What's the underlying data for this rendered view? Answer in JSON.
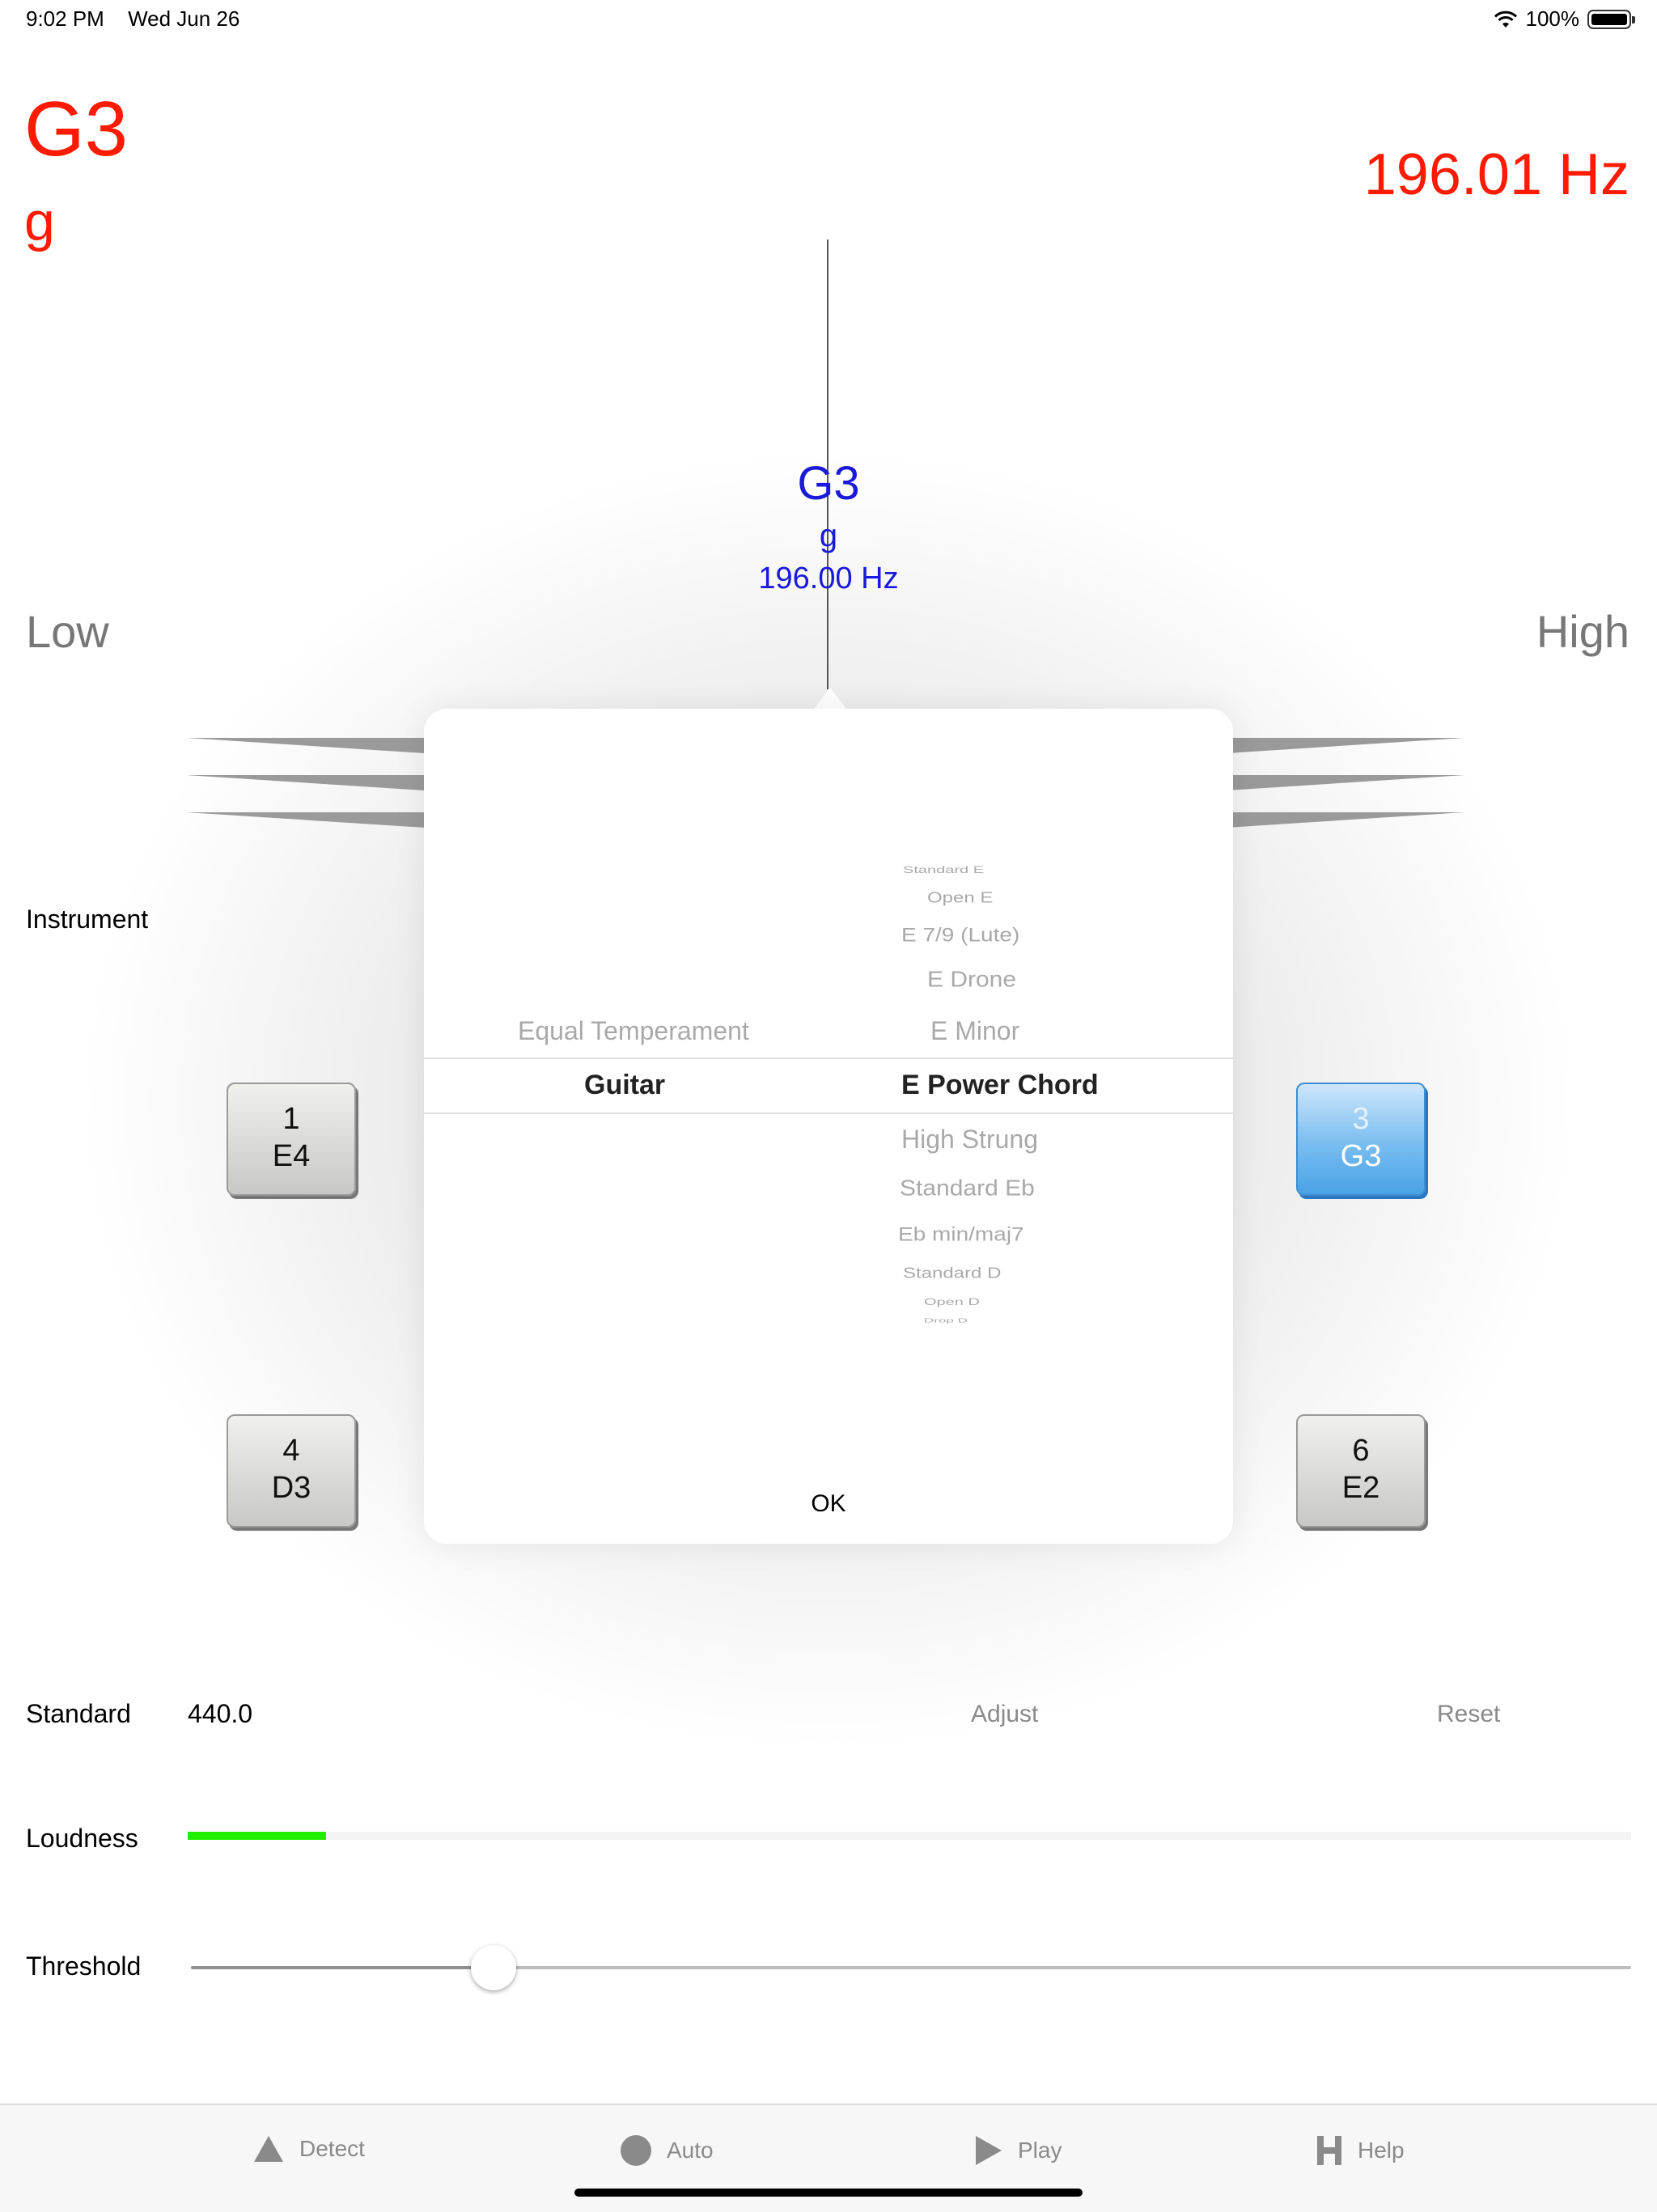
{
  "status": {
    "time": "9:02 PM",
    "date": "Wed Jun 26",
    "battery": "100%"
  },
  "detected": {
    "note": "G3",
    "solfege": "g",
    "frequency": "196.01",
    "unit": "Hz"
  },
  "target": {
    "note": "G3",
    "solfege": "g",
    "frequency": "196.00 Hz"
  },
  "meter": {
    "low": "Low",
    "high": "High"
  },
  "instrument": {
    "label": "Instrument"
  },
  "strings": [
    {
      "num": "1",
      "note": "E4"
    },
    {
      "num": "3",
      "note": "G3"
    },
    {
      "num": "4",
      "note": "D3"
    },
    {
      "num": "6",
      "note": "E2"
    }
  ],
  "picker": {
    "left_above": "Equal Temperament",
    "left_selected": "Guitar",
    "right_above": [
      "Standard E",
      "Open E",
      "E 7/9 (Lute)",
      "E Drone",
      "E Minor"
    ],
    "right_selected": "E Power Chord",
    "right_below": [
      "High Strung",
      "Standard Eb",
      "Eb min/maj7",
      "Standard D",
      "Open D",
      "Drop D"
    ],
    "ok": "OK"
  },
  "standard": {
    "label": "Standard",
    "value": "440.0",
    "adjust": "Adjust",
    "reset": "Reset"
  },
  "loudness": {
    "label": "Loudness",
    "level": 0.096
  },
  "threshold": {
    "label": "Threshold",
    "level": 0.21
  },
  "tabs": [
    {
      "label": "Detect",
      "icon": "triangle-icon"
    },
    {
      "label": "Auto",
      "icon": "circle-icon"
    },
    {
      "label": "Play",
      "icon": "play-icon"
    },
    {
      "label": "Help",
      "icon": "h-icon"
    }
  ]
}
